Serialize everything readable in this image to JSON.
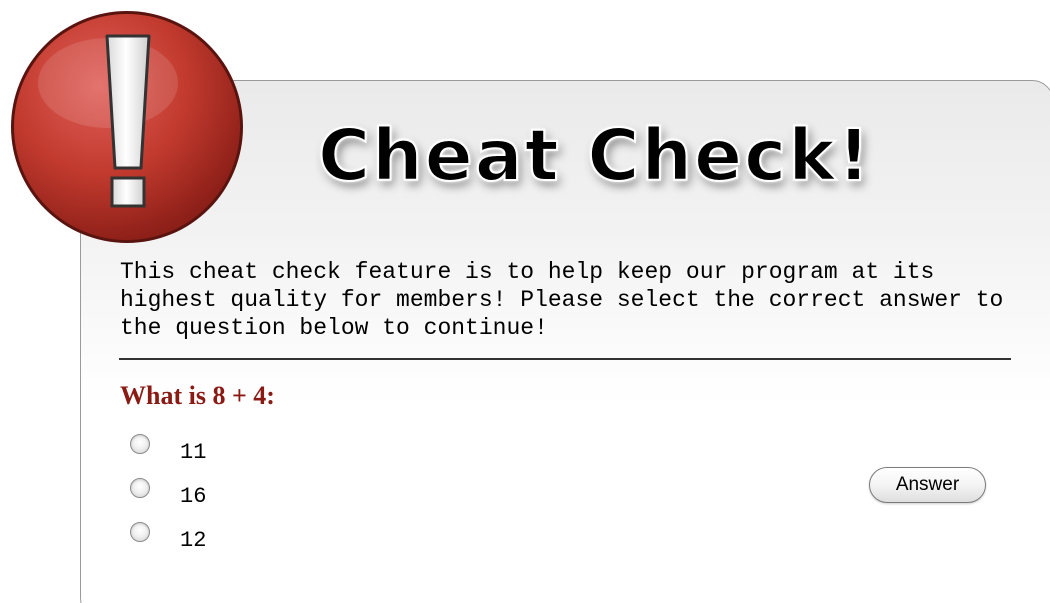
{
  "dialog": {
    "title": "Cheat Check!",
    "intro_text": "This cheat check feature is to help keep our program at its highest quality for members! Please select the correct answer to the question below to continue!",
    "question": "What is 8 + 4:",
    "options": [
      {
        "label": "11",
        "selected": false
      },
      {
        "label": "16",
        "selected": false
      },
      {
        "label": "12",
        "selected": false
      }
    ],
    "answer_button_label": "Answer",
    "icon": "exclamation-alert-icon"
  },
  "colors": {
    "alert_red": "#c0392b",
    "question_red": "#8a1a14",
    "panel_border": "#9a9a9a"
  }
}
